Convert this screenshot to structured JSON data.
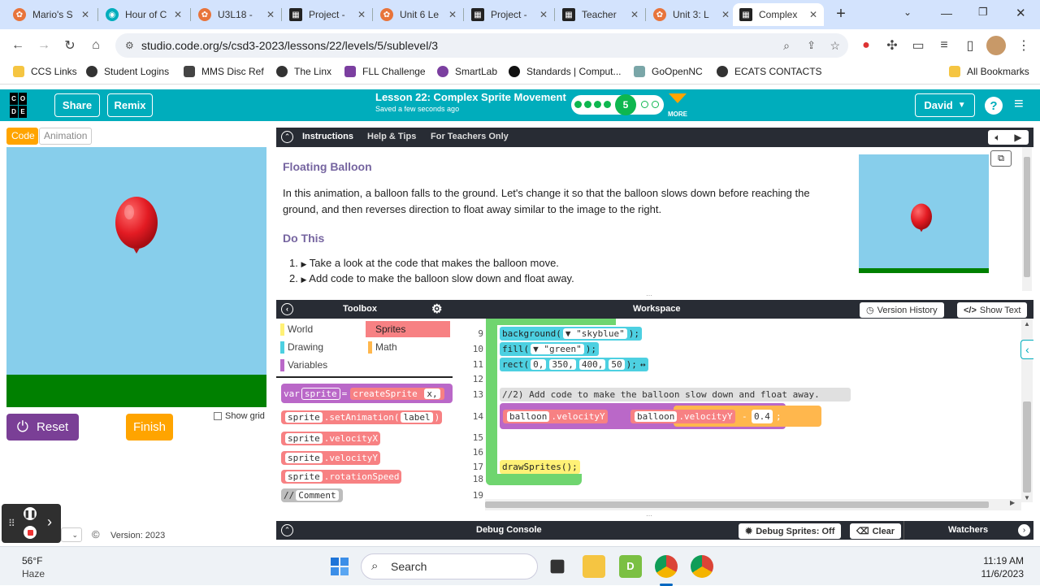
{
  "browser": {
    "tabs": [
      {
        "label": "Mario's S",
        "color": "#e8743b"
      },
      {
        "label": "Hour of C",
        "color": "#00adbc"
      },
      {
        "label": "U3L18 -",
        "color": "#e8743b"
      },
      {
        "label": "Project -",
        "color": "#222222"
      },
      {
        "label": "Unit 6 Le",
        "color": "#e8743b"
      },
      {
        "label": "Project -",
        "color": "#222222"
      },
      {
        "label": "Teacher",
        "color": "#222222"
      },
      {
        "label": "Unit 3: L",
        "color": "#e8743b"
      },
      {
        "label": "Complex",
        "color": "#222222"
      }
    ],
    "new_tab": "+",
    "url": "studio.code.org/s/csd3-2023/lessons/22/levels/5/sublevel/3",
    "bookmarks": [
      "CCS Links",
      "Student Logins",
      "MMS Disc Ref",
      "The Linx",
      "FLL Challenge",
      "SmartLab",
      "Standards | Comput...",
      "GoOpenNC",
      "ECATS CONTACTS"
    ],
    "all_bookmarks": "All Bookmarks"
  },
  "header": {
    "logo_letters": [
      "C",
      "O",
      "D",
      "E"
    ],
    "share": "Share",
    "remix": "Remix",
    "lesson_title": "Lesson 22: Complex Sprite Movement",
    "saved": "Saved a few seconds ago",
    "current_level": "5",
    "more": "MORE",
    "user": "David",
    "help": "?"
  },
  "left": {
    "tab_code": "Code",
    "tab_animation": "Animation",
    "reset": "Reset",
    "finish": "Finish",
    "show_grid": "Show grid",
    "version": "Version: 2023"
  },
  "instructions": {
    "tabs": [
      "Instructions",
      "Help & Tips",
      "For Teachers Only"
    ],
    "title": "Floating Balloon",
    "body": "In this animation, a balloon falls to the ground. Let's change it so that the balloon slows down before reaching the ground, and then reverses direction to float away similar to the image to the right.",
    "do_this": "Do This",
    "steps": [
      "Take a look at the code that makes the balloon move.",
      "Add code to make the balloon slow down and float away."
    ],
    "step_numbers": [
      "1.",
      "2."
    ]
  },
  "toolbox": {
    "title": "Toolbox",
    "categories": [
      {
        "label": "World",
        "color": "#fff176"
      },
      {
        "label": "Sprites",
        "color": "#f78183"
      },
      {
        "label": "Drawing",
        "color": "#4dd0e1"
      },
      {
        "label": "Math",
        "color": "#ffb74d"
      },
      {
        "label": "Variables",
        "color": "#ba68c8"
      }
    ],
    "blocks": [
      {
        "kw": "var",
        "v1": "sprite",
        "op": "=",
        "v2": "createSprite",
        "v3": "x,"
      },
      {
        "obj": "sprite",
        "method": ".setAnimation",
        "arg": "label"
      },
      {
        "obj": "sprite",
        "method": ".velocityX"
      },
      {
        "obj": "sprite",
        "method": ".velocityY"
      },
      {
        "obj": "sprite",
        "method": ".rotationSpeed"
      },
      {
        "kw": "//",
        "arg": "Comment"
      }
    ]
  },
  "workspace": {
    "title": "Workspace",
    "version_history": "Version History",
    "show_text": "Show Text",
    "line_numbers": [
      "9",
      "10",
      "11",
      "12",
      "13",
      "14",
      "15",
      "16",
      "17",
      "18",
      "19"
    ],
    "code": {
      "l9_fn": "background(",
      "l9_arg": "\"skyblue\"",
      "l9_end": ");",
      "l10_fn": "fill(",
      "l10_arg": "\"green\"",
      "l10_end": ");",
      "l11_fn": "rect(",
      "l11_args": [
        "0,",
        "350,",
        "400,",
        "50"
      ],
      "l11_end": ");",
      "l13_comment": "//2) Add code to make the balloon slow down and float away.",
      "l14_obj": "balloon",
      "l14_prop": ".velocityY",
      "l14_eq": "=",
      "l14_obj2": "balloon",
      "l14_prop2": ".velocityY",
      "l14_op": "-",
      "l14_val": "0.4",
      "l14_end": ";",
      "l17": "drawSprites();"
    }
  },
  "debug": {
    "console": "Debug Console",
    "debug_sprites": "Debug Sprites: Off",
    "clear": "Clear",
    "watchers": "Watchers"
  },
  "taskbar": {
    "weather_temp": "56°F",
    "weather_desc": "Haze",
    "search": "Search",
    "time": "11:19 AM",
    "date": "11/6/2023"
  },
  "colors": {
    "teal": "#00adbc",
    "purple": "#7a3f96",
    "orange": "#ffa400",
    "sky": "#87ceeb",
    "ground": "#008000",
    "balloon": "#e31b23"
  }
}
